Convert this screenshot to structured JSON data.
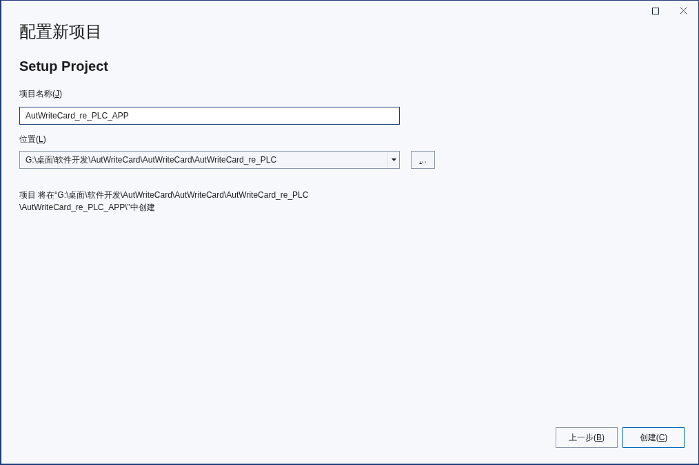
{
  "title": "配置新项目",
  "subtitle": "Setup Project",
  "fields": [
    {
      "kind": "text",
      "label": {
        "before": "项目名称(",
        "access_key": "J",
        "after": ")"
      },
      "value": "AutWriteCard_re_PLC_APP",
      "focused": true
    },
    {
      "kind": "combo",
      "label": {
        "before": "位置(",
        "access_key": "L",
        "after": ")"
      },
      "value": "G:\\桌面\\软件开发\\AutWriteCard\\AutWriteCard\\AutWriteCard_re_PLC",
      "focused": false,
      "browse_button": {
        "access_key": ".",
        "after": ".."
      }
    }
  ],
  "info": {
    "lines": [
      "项目 将在“G:\\桌面\\软件开发\\AutWriteCard\\AutWriteCard\\AutWriteCard_re_PLC",
      "\\AutWriteCard_re_PLC_APP\\”中创建"
    ]
  },
  "buttons": [
    {
      "label": {
        "before": "上一步(",
        "access_key": "B",
        "after": ")"
      },
      "default": false
    },
    {
      "label": {
        "before": "创建(",
        "access_key": "C",
        "after": ")"
      },
      "default": true
    }
  ]
}
